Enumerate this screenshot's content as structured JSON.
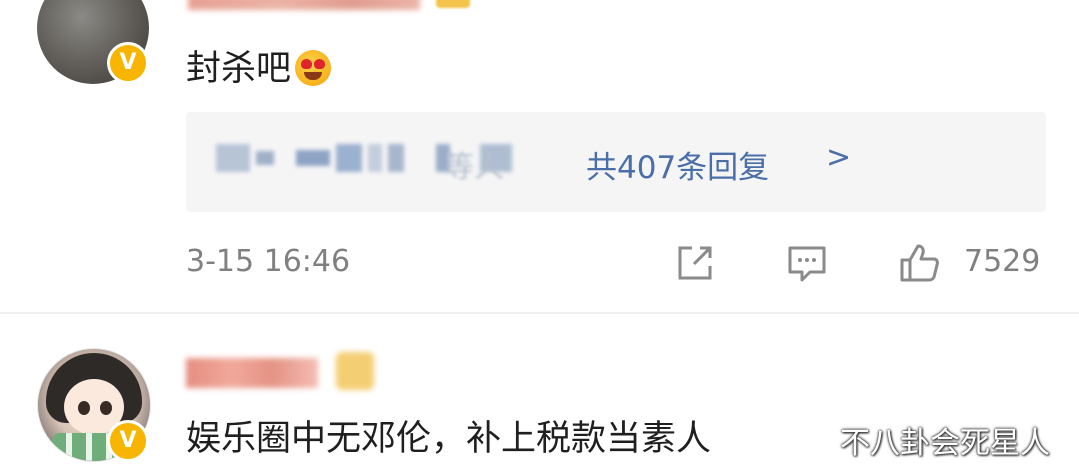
{
  "comments": [
    {
      "text": "封杀吧",
      "emoji": "heart-eyes-emoji",
      "reply_summary": {
        "visible_tail": "等人",
        "count_text": "共407条回复",
        "chevron": ">"
      },
      "timestamp": "3-15 16:46",
      "like_count": "7529"
    },
    {
      "text": "娱乐圈中无邓伦，补上税款当素人"
    }
  ],
  "watermark": "不八卦会死星人",
  "colors": {
    "reply_link": "#4a6ea8",
    "meta_text": "#808080",
    "reply_bg": "#f5f5f6",
    "verified_badge": "#f7b500"
  }
}
